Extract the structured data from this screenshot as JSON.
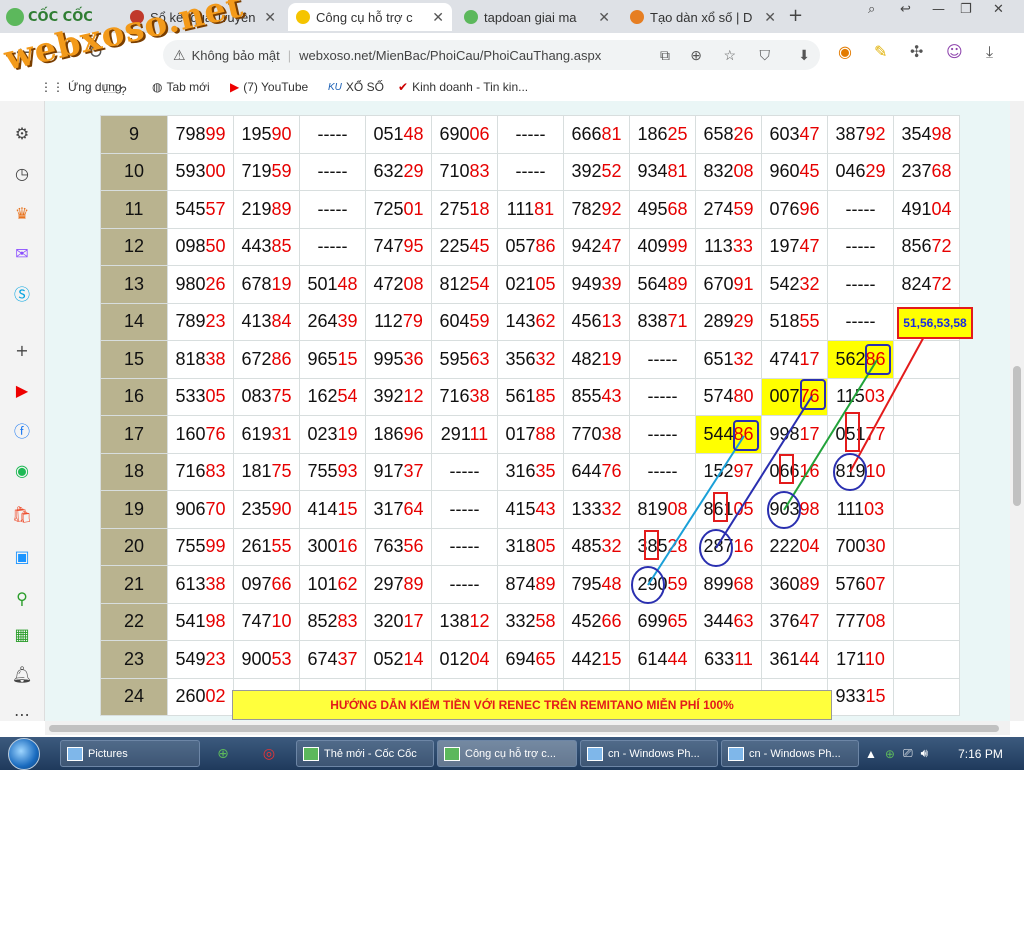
{
  "browser": {
    "brand": "CỐC CỐC",
    "tabs": [
      {
        "title": "Sổ kết quả Truyền",
        "active": false
      },
      {
        "title": "Công cụ hỗ trợ c",
        "active": true
      },
      {
        "title": "tapdoan giai ma",
        "active": false
      },
      {
        "title": "Tạo dàn xổ số | D",
        "active": false
      }
    ],
    "insecure_label": "Không bảo mật",
    "url": "webxoso.net/MienBac/PhoiCau/PhoiCauThang.aspx",
    "bookmarks": [
      {
        "label": "Ứng dụng"
      },
      {
        "label": "?"
      },
      {
        "label": "Tab mới"
      },
      {
        "label": "(7) YouTube"
      },
      {
        "label": "XỔ SỐ"
      },
      {
        "label": "Kinh doanh - Tin kin..."
      }
    ]
  },
  "watermark": "webxoso.net",
  "colors": {
    "highlight": "#ffff00",
    "red_digits": "#e60000",
    "row_header": "#b9b38f",
    "banner_text": "#e31b1b",
    "marker_blue": "#2a2fb0"
  },
  "grid": {
    "rows": [
      {
        "n": "9",
        "cells": [
          [
            "798",
            "99"
          ],
          [
            "195",
            "90"
          ],
          [
            "-----",
            ""
          ],
          [
            "051",
            "48"
          ],
          [
            "690",
            "06"
          ],
          [
            "-----",
            ""
          ],
          [
            "666",
            "81"
          ],
          [
            "186",
            "25"
          ],
          [
            "658",
            "26"
          ],
          [
            "603",
            "47"
          ],
          [
            "387",
            "92"
          ],
          [
            "354",
            "98"
          ]
        ]
      },
      {
        "n": "10",
        "cells": [
          [
            "593",
            "00"
          ],
          [
            "719",
            "59"
          ],
          [
            "-----",
            ""
          ],
          [
            "632",
            "29"
          ],
          [
            "710",
            "83"
          ],
          [
            "-----",
            ""
          ],
          [
            "392",
            "52"
          ],
          [
            "934",
            "81"
          ],
          [
            "832",
            "08"
          ],
          [
            "960",
            "45"
          ],
          [
            "046",
            "29"
          ],
          [
            "237",
            "68"
          ]
        ]
      },
      {
        "n": "11",
        "cells": [
          [
            "545",
            "57"
          ],
          [
            "219",
            "89"
          ],
          [
            "-----",
            ""
          ],
          [
            "725",
            "01"
          ],
          [
            "275",
            "18"
          ],
          [
            "111",
            "81"
          ],
          [
            "782",
            "92"
          ],
          [
            "495",
            "68"
          ],
          [
            "274",
            "59"
          ],
          [
            "076",
            "96"
          ],
          [
            "-----",
            ""
          ],
          [
            "491",
            "04"
          ]
        ]
      },
      {
        "n": "12",
        "cells": [
          [
            "098",
            "50"
          ],
          [
            "443",
            "85"
          ],
          [
            "-----",
            ""
          ],
          [
            "747",
            "95"
          ],
          [
            "225",
            "45"
          ],
          [
            "057",
            "86"
          ],
          [
            "942",
            "47"
          ],
          [
            "409",
            "99"
          ],
          [
            "113",
            "33"
          ],
          [
            "197",
            "47"
          ],
          [
            "-----",
            ""
          ],
          [
            "856",
            "72"
          ]
        ]
      },
      {
        "n": "13",
        "cells": [
          [
            "980",
            "26"
          ],
          [
            "678",
            "19"
          ],
          [
            "501",
            "48"
          ],
          [
            "472",
            "08"
          ],
          [
            "812",
            "54"
          ],
          [
            "021",
            "05"
          ],
          [
            "949",
            "39"
          ],
          [
            "564",
            "89"
          ],
          [
            "670",
            "91"
          ],
          [
            "542",
            "32"
          ],
          [
            "-----",
            ""
          ],
          [
            "824",
            "72"
          ]
        ]
      },
      {
        "n": "14",
        "cells": [
          [
            "789",
            "23"
          ],
          [
            "413",
            "84"
          ],
          [
            "264",
            "39"
          ],
          [
            "112",
            "79"
          ],
          [
            "604",
            "59"
          ],
          [
            "143",
            "62"
          ],
          [
            "456",
            "13"
          ],
          [
            "838",
            "71"
          ],
          [
            "289",
            "29"
          ],
          [
            "518",
            "55"
          ],
          [
            "-----",
            ""
          ],
          [
            "",
            ""
          ]
        ]
      },
      {
        "n": "15",
        "cells": [
          [
            "818",
            "38"
          ],
          [
            "672",
            "86"
          ],
          [
            "965",
            "15"
          ],
          [
            "995",
            "36"
          ],
          [
            "595",
            "63"
          ],
          [
            "356",
            "32"
          ],
          [
            "482",
            "19"
          ],
          [
            "-----",
            ""
          ],
          [
            "651",
            "32"
          ],
          [
            "474",
            "17"
          ],
          [
            "562",
            "86"
          ],
          [
            "",
            ""
          ]
        ]
      },
      {
        "n": "16",
        "cells": [
          [
            "533",
            "05"
          ],
          [
            "083",
            "75"
          ],
          [
            "162",
            "54"
          ],
          [
            "392",
            "12"
          ],
          [
            "716",
            "38"
          ],
          [
            "561",
            "85"
          ],
          [
            "855",
            "43"
          ],
          [
            "-----",
            ""
          ],
          [
            "574",
            "80"
          ],
          [
            "007",
            "76"
          ],
          [
            "115",
            "03"
          ],
          [
            "",
            ""
          ]
        ]
      },
      {
        "n": "17",
        "cells": [
          [
            "160",
            "76"
          ],
          [
            "619",
            "31"
          ],
          [
            "023",
            "19"
          ],
          [
            "186",
            "96"
          ],
          [
            "291",
            "11"
          ],
          [
            "017",
            "88"
          ],
          [
            "770",
            "38"
          ],
          [
            "-----",
            ""
          ],
          [
            "544",
            "86"
          ],
          [
            "998",
            "17"
          ],
          [
            "051",
            "77"
          ],
          [
            "",
            ""
          ]
        ]
      },
      {
        "n": "18",
        "cells": [
          [
            "716",
            "83"
          ],
          [
            "181",
            "75"
          ],
          [
            "755",
            "93"
          ],
          [
            "917",
            "37"
          ],
          [
            "-----",
            ""
          ],
          [
            "316",
            "35"
          ],
          [
            "644",
            "76"
          ],
          [
            "-----",
            ""
          ],
          [
            "152",
            "97"
          ],
          [
            "066",
            "16"
          ],
          [
            "819",
            "10"
          ],
          [
            "",
            ""
          ]
        ]
      },
      {
        "n": "19",
        "cells": [
          [
            "906",
            "70"
          ],
          [
            "235",
            "90"
          ],
          [
            "414",
            "15"
          ],
          [
            "317",
            "64"
          ],
          [
            "-----",
            ""
          ],
          [
            "415",
            "43"
          ],
          [
            "133",
            "32"
          ],
          [
            "819",
            "08"
          ],
          [
            "861",
            "05"
          ],
          [
            "903",
            "98"
          ],
          [
            "111",
            "03"
          ],
          [
            "",
            ""
          ]
        ]
      },
      {
        "n": "20",
        "cells": [
          [
            "755",
            "99"
          ],
          [
            "261",
            "55"
          ],
          [
            "300",
            "16"
          ],
          [
            "763",
            "56"
          ],
          [
            "-----",
            ""
          ],
          [
            "318",
            "05"
          ],
          [
            "485",
            "32"
          ],
          [
            "385",
            "28"
          ],
          [
            "287",
            "16"
          ],
          [
            "222",
            "04"
          ],
          [
            "700",
            "30"
          ],
          [
            "",
            ""
          ]
        ]
      },
      {
        "n": "21",
        "cells": [
          [
            "613",
            "38"
          ],
          [
            "097",
            "66"
          ],
          [
            "101",
            "62"
          ],
          [
            "297",
            "89"
          ],
          [
            "-----",
            ""
          ],
          [
            "874",
            "89"
          ],
          [
            "795",
            "48"
          ],
          [
            "290",
            "59"
          ],
          [
            "899",
            "68"
          ],
          [
            "360",
            "89"
          ],
          [
            "576",
            "07"
          ],
          [
            "",
            ""
          ]
        ]
      },
      {
        "n": "22",
        "cells": [
          [
            "541",
            "98"
          ],
          [
            "747",
            "10"
          ],
          [
            "852",
            "83"
          ],
          [
            "320",
            "17"
          ],
          [
            "138",
            "12"
          ],
          [
            "332",
            "58"
          ],
          [
            "452",
            "66"
          ],
          [
            "699",
            "65"
          ],
          [
            "344",
            "63"
          ],
          [
            "376",
            "47"
          ],
          [
            "777",
            "08"
          ],
          [
            "",
            ""
          ]
        ]
      },
      {
        "n": "23",
        "cells": [
          [
            "549",
            "23"
          ],
          [
            "900",
            "53"
          ],
          [
            "674",
            "37"
          ],
          [
            "052",
            "14"
          ],
          [
            "012",
            "04"
          ],
          [
            "694",
            "65"
          ],
          [
            "442",
            "15"
          ],
          [
            "614",
            "44"
          ],
          [
            "633",
            "11"
          ],
          [
            "361",
            "44"
          ],
          [
            "171",
            "10"
          ],
          [
            "",
            ""
          ]
        ]
      },
      {
        "n": "24",
        "cells": [
          [
            "260",
            "02"
          ],
          [
            "",
            ""
          ],
          [
            "",
            ""
          ],
          [
            "",
            ""
          ],
          [
            "",
            ""
          ],
          [
            "",
            ""
          ],
          [
            "",
            ""
          ],
          [
            "",
            ""
          ],
          [
            "",
            ""
          ],
          [
            "",
            ""
          ],
          [
            "933",
            "15"
          ],
          [
            "",
            ""
          ]
        ]
      }
    ],
    "highlighted": [
      {
        "row": "15",
        "col": 10
      },
      {
        "row": "16",
        "col": 9
      },
      {
        "row": "17",
        "col": 8
      }
    ]
  },
  "summary_box": "51,56,53,58",
  "banner": "HƯỚNG DẪN KIẾM TIỀN VỚI RENEC TRÊN REMITANO MIỄN PHÍ 100%",
  "taskbar": {
    "items": [
      {
        "label": "Pictures"
      },
      {
        "label": "Thẻ mới - Cốc Cốc"
      },
      {
        "label": "Công cụ hỗ trợ c..."
      },
      {
        "label": "cn - Windows Ph..."
      },
      {
        "label": "cn - Windows Ph..."
      }
    ],
    "clock": "7:16 PM"
  }
}
